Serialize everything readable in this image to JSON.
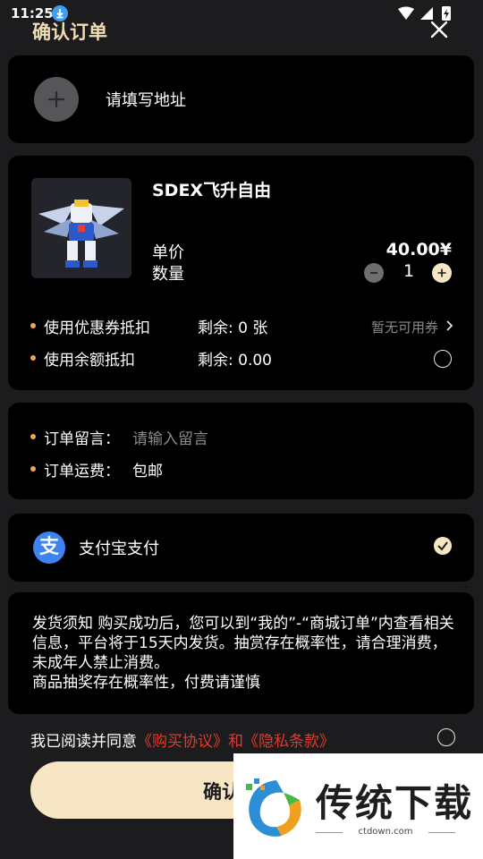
{
  "status_bar": {
    "time": "11:25"
  },
  "header": {
    "title": "确认订单"
  },
  "address": {
    "label": "请填写地址"
  },
  "product": {
    "name": "SDEX飞升自由",
    "unit_price_label": "单价",
    "unit_price": "40.00¥",
    "quantity_label": "数量",
    "quantity": "1",
    "coupon": {
      "label": "使用优惠券抵扣",
      "remaining": "剩余: 0 张",
      "status": "暂无可用券"
    },
    "balance": {
      "label": "使用余额抵扣",
      "remaining": "剩余: 0.00"
    }
  },
  "order": {
    "message_label": "订单留言：",
    "message_placeholder": "请输入留言",
    "shipping_label": "订单运费：",
    "shipping_value": "包邮"
  },
  "payment": {
    "method": "支付宝支付",
    "icon_glyph": "支"
  },
  "notice": {
    "line1": "发货须知  购买成功后，您可以到“我的”-“商城订单”内查看相关信息，平台将于15天内发货。抽赏存在概率性，请合理消费，未成年人禁止消费。",
    "line2": "商品抽奖存在概率性，付费请谨慎"
  },
  "agreement": {
    "prefix": "我已阅读并同意",
    "purchase": "《购买协议》",
    "and": "和",
    "privacy": "《隐私条款》"
  },
  "confirm_button": {
    "label": "确认支付"
  },
  "watermark": {
    "brand": "传统下载",
    "url": "ctdown.com"
  },
  "colors": {
    "accent": "#f6e6c4",
    "title": "#f1ddb4",
    "bullet": "#f0a650",
    "link_red": "#e03a2c",
    "alipay": "#3d84f0"
  }
}
